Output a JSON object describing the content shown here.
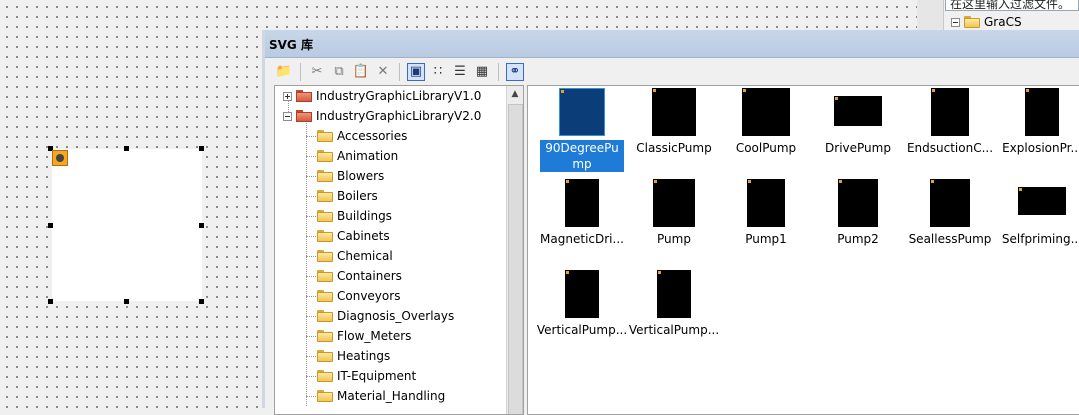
{
  "right_panel": {
    "filter_text": "在这里输入过滤文件。",
    "tree_node": "GraCS"
  },
  "window": {
    "title": "SVG 库"
  },
  "toolbar": {
    "icons": [
      "new-folder-icon",
      "cut-icon",
      "copy-icon",
      "paste-icon",
      "delete-icon",
      "large-icons-view-icon",
      "small-icons-view-icon",
      "list-view-icon",
      "details-view-icon",
      "preview-icon"
    ]
  },
  "tree": {
    "roots": [
      {
        "label": "IndustryGraphicLibraryV1.0",
        "expanded": false
      },
      {
        "label": "IndustryGraphicLibraryV2.0",
        "expanded": true
      }
    ],
    "children": [
      "Accessories",
      "Animation",
      "Blowers",
      "Boilers",
      "Buildings",
      "Cabinets",
      "Chemical",
      "Containers",
      "Conveyors",
      "Diagnosis_Overlays",
      "Flow_Meters",
      "Heatings",
      "IT-Equipment",
      "Material_Handling"
    ]
  },
  "items": [
    {
      "label": "90DegreePump",
      "selected": true
    },
    {
      "label": "ClassicPump"
    },
    {
      "label": "CoolPump"
    },
    {
      "label": "DrivePump"
    },
    {
      "label": "EndsuctionC..."
    },
    {
      "label": "ExplosionPr..."
    },
    {
      "label": "MagneticDri..."
    },
    {
      "label": "Pump"
    },
    {
      "label": "Pump1"
    },
    {
      "label": "Pump2"
    },
    {
      "label": "SeallessPump"
    },
    {
      "label": "Selfpriming..."
    },
    {
      "label": "VerticalPump..."
    },
    {
      "label": "VerticalPump..."
    }
  ]
}
